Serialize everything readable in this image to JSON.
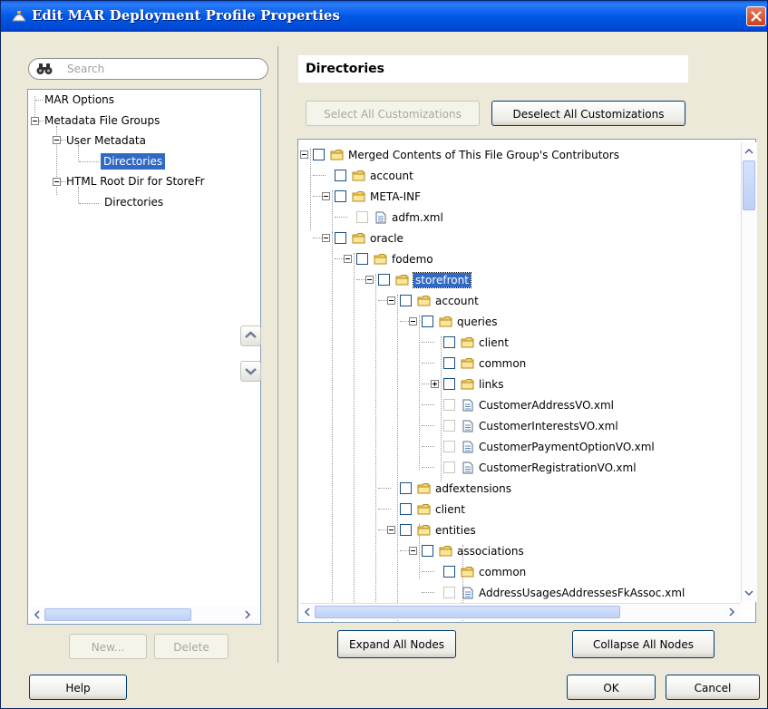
{
  "window": {
    "title": "Edit MAR Deployment Profile Properties",
    "close_icon": "close-icon"
  },
  "search": {
    "placeholder": "Search"
  },
  "left_tree": {
    "items": [
      {
        "label": "MAR Options"
      },
      {
        "label": "Metadata File Groups"
      },
      {
        "label": "User Metadata"
      },
      {
        "label": "Directories",
        "selected": true
      },
      {
        "label": "HTML Root Dir for StoreFr"
      },
      {
        "label": "Directories"
      }
    ]
  },
  "left_buttons": {
    "new": "New...",
    "delete": "Delete"
  },
  "section": {
    "title": "Directories"
  },
  "customizations": {
    "select_all": "Select All Customizations",
    "deselect_all": "Deselect All Customizations"
  },
  "tree": {
    "nodes": [
      {
        "label": "Merged Contents of This File Group's Contributors",
        "type": "folder"
      },
      {
        "label": "account",
        "type": "folder"
      },
      {
        "label": "META-INF",
        "type": "folder"
      },
      {
        "label": "adfm.xml",
        "type": "file"
      },
      {
        "label": "oracle",
        "type": "folder"
      },
      {
        "label": "fodemo",
        "type": "folder"
      },
      {
        "label": "storefront",
        "type": "folder",
        "selected": true
      },
      {
        "label": "account",
        "type": "folder"
      },
      {
        "label": "queries",
        "type": "folder"
      },
      {
        "label": "client",
        "type": "folder"
      },
      {
        "label": "common",
        "type": "folder"
      },
      {
        "label": "links",
        "type": "folder"
      },
      {
        "label": "CustomerAddressVO.xml",
        "type": "file"
      },
      {
        "label": "CustomerInterestsVO.xml",
        "type": "file"
      },
      {
        "label": "CustomerPaymentOptionVO.xml",
        "type": "file"
      },
      {
        "label": "CustomerRegistrationVO.xml",
        "type": "file"
      },
      {
        "label": "adfextensions",
        "type": "folder"
      },
      {
        "label": "client",
        "type": "folder"
      },
      {
        "label": "entities",
        "type": "folder"
      },
      {
        "label": "associations",
        "type": "folder"
      },
      {
        "label": "common",
        "type": "folder"
      },
      {
        "label": "AddressUsagesAddressesFkAssoc.xml",
        "type": "file"
      }
    ]
  },
  "tree_buttons": {
    "expand": "Expand All Nodes",
    "collapse": "Collapse All Nodes"
  },
  "footer": {
    "help": "Help",
    "ok": "OK",
    "cancel": "Cancel"
  },
  "colors": {
    "titlebar": "#0058E6",
    "selection": "#316AC5",
    "dialog_bg": "#ECE9D8"
  }
}
